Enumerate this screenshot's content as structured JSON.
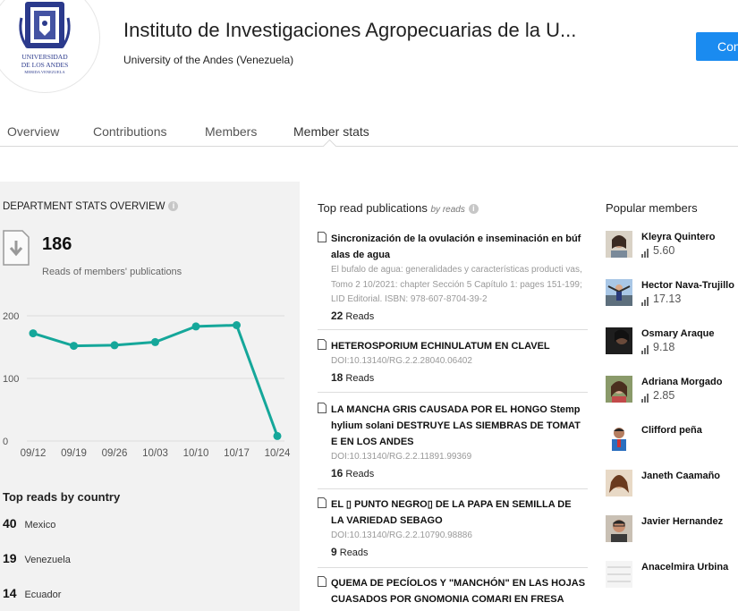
{
  "header": {
    "institution_name": "Instituto de Investigaciones Agropecuarias de la U...",
    "university": "University of the Andes (Venezuela)",
    "connect_label": "Con",
    "logo_text_line1": "UNIVERSIDAD",
    "logo_text_line2": "DE LOS ANDES",
    "logo_text_line3": "MERIDA VENEZUELA"
  },
  "tabs": [
    {
      "label": "Overview"
    },
    {
      "label": "Contributions"
    },
    {
      "label": "Members"
    },
    {
      "label": "Member stats",
      "active": true
    }
  ],
  "overview": {
    "title": "DEPARTMENT STATS OVERVIEW",
    "total_reads": "186",
    "reads_label": "Reads of members' publications"
  },
  "chart_data": {
    "type": "line",
    "categories": [
      "09/12",
      "09/19",
      "09/26",
      "10/03",
      "10/10",
      "10/17",
      "10/24"
    ],
    "values": [
      172,
      152,
      153,
      158,
      183,
      185,
      8
    ],
    "yticks": [
      "0",
      "100",
      "200"
    ],
    "ylim": [
      0,
      200
    ],
    "color": "#15a79a"
  },
  "countries": {
    "title": "Top reads by country",
    "items": [
      {
        "count": "40",
        "name": "Mexico"
      },
      {
        "count": "19",
        "name": "Venezuela"
      },
      {
        "count": "14",
        "name": "Ecuador"
      }
    ]
  },
  "publications": {
    "title": "Top read publications",
    "by": "by reads",
    "items": [
      {
        "title": "Sincronización de la ovulación e inseminación en búf alas de agua",
        "meta": "El bufalo de agua: generalidades y características producti vas, Tomo 2 10/2021: chapter Sección 5 Capítulo 1: pages 151-199; LID Editorial. ISBN: 978-607-8704-39-2",
        "reads_count": "22",
        "reads_word": "Reads"
      },
      {
        "title": "HETEROSPORIUM ECHINULATUM EN CLAVEL",
        "meta": "DOI:10.13140/RG.2.2.28040.06402",
        "reads_count": "18",
        "reads_word": "Reads"
      },
      {
        "title": "LA MANCHA GRIS CAUSADA POR EL HONGO Stemp hylium solani DESTRUYE LAS SIEMBRAS DE TOMAT E EN LOS ANDES",
        "meta": "DOI:10.13140/RG.2.2.11891.99369",
        "reads_count": "16",
        "reads_word": "Reads"
      },
      {
        "title": "EL ▯ PUNTO NEGRO▯ DE LA PAPA EN SEMILLA DE LA VARIEDAD SEBAGO",
        "meta": "DOI:10.13140/RG.2.2.10790.98886",
        "reads_count": "9",
        "reads_word": "Reads"
      },
      {
        "title": "QUEMA DE PECÍOLOS Y \"MANCHÓN\" EN LAS HOJAS CUASADOS POR GNOMONIA COMARI EN FRESA",
        "meta": "",
        "reads_count": "",
        "reads_word": ""
      }
    ]
  },
  "members": {
    "title": "Popular members",
    "items": [
      {
        "name": "Kleyra Quintero",
        "score": "5.60"
      },
      {
        "name": "Hector Nava-Trujillo",
        "score": "17.13"
      },
      {
        "name": "Osmary Araque",
        "score": "9.18"
      },
      {
        "name": "Adriana Morgado",
        "score": "2.85"
      },
      {
        "name": "Clifford peña",
        "score": ""
      },
      {
        "name": "Janeth Caamaño",
        "score": ""
      },
      {
        "name": "Javier Hernandez",
        "score": ""
      },
      {
        "name": "Anacelmira Urbina",
        "score": ""
      }
    ]
  }
}
